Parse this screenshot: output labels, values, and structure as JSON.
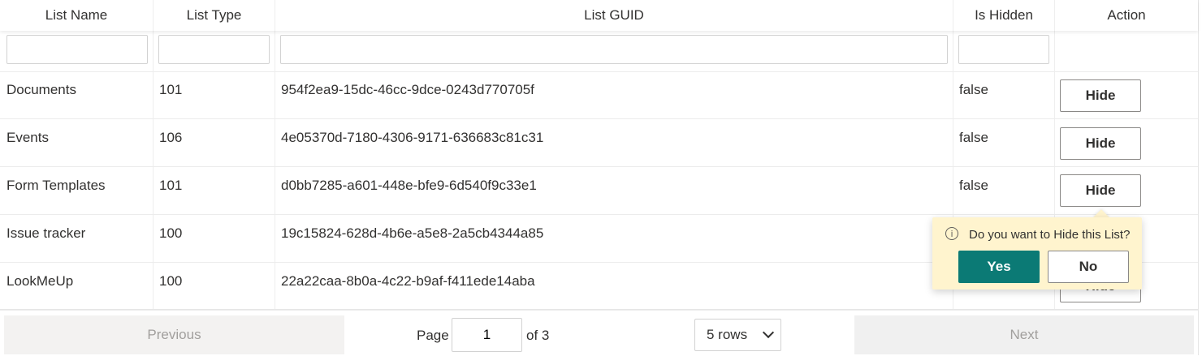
{
  "columns": {
    "list_name": "List Name",
    "list_type": "List Type",
    "list_guid": "List GUID",
    "is_hidden": "Is Hidden",
    "action": "Action"
  },
  "filters": {
    "list_name": "",
    "list_type": "",
    "list_guid": "",
    "is_hidden": ""
  },
  "rows": [
    {
      "name": "Documents",
      "type": "101",
      "guid": "954f2ea9-15dc-46cc-9dce-0243d770705f",
      "hidden": "false",
      "action": "Hide"
    },
    {
      "name": "Events",
      "type": "106",
      "guid": "4e05370d-7180-4306-9171-636683c81c31",
      "hidden": "false",
      "action": "Hide"
    },
    {
      "name": "Form Templates",
      "type": "101",
      "guid": "d0bb7285-a601-448e-bfe9-6d540f9c33e1",
      "hidden": "false",
      "action": "Hide"
    },
    {
      "name": "Issue tracker",
      "type": "100",
      "guid": "19c15824-628d-4b6e-a5e8-2a5cb4344a85",
      "hidden": "",
      "action": ""
    },
    {
      "name": "LookMeUp",
      "type": "100",
      "guid": "22a22caa-8b0a-4c22-b9af-f411ede14aba",
      "hidden": "",
      "action": "Hide"
    }
  ],
  "callout": {
    "icon": "info-icon",
    "message": "Do you want to Hide this List?",
    "yes_label": "Yes",
    "no_label": "No"
  },
  "pager": {
    "previous_label": "Previous",
    "page_label": "Page",
    "current_page": "1",
    "of_label": "of 3",
    "rows_label": "5 rows",
    "next_label": "Next"
  },
  "colors": {
    "accent": "#0b7a75",
    "callout_bg": "#fff4ce"
  }
}
